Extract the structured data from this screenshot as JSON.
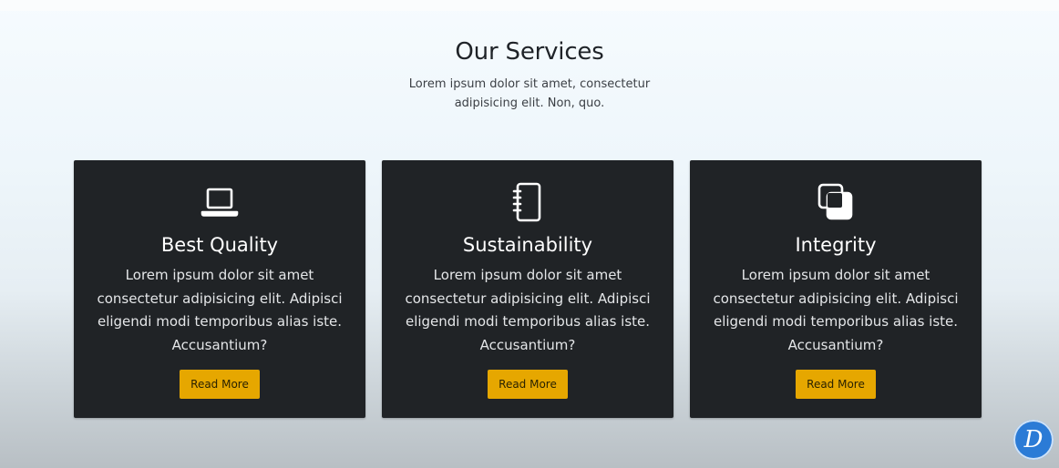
{
  "section": {
    "title": "Our Services",
    "subtitle": "Lorem ipsum dolor sit amet, consectetur adipisicing elit. Non, quo."
  },
  "cards": [
    {
      "icon": "laptop-icon",
      "title": "Best Quality",
      "text": "Lorem ipsum dolor sit amet consectetur adipisicing elit. Adipisci eligendi modi temporibus alias iste. Accusantium?",
      "button_label": "Read More"
    },
    {
      "icon": "notebook-icon",
      "title": "Sustainability",
      "text": "Lorem ipsum dolor sit amet consectetur adipisicing elit. Adipisci eligendi modi temporibus alias iste. Accusantium?",
      "button_label": "Read More"
    },
    {
      "icon": "overlapping-squares-icon",
      "title": "Integrity",
      "text": "Lorem ipsum dolor sit amet consectetur adipisicing elit. Adipisci eligendi modi temporibus alias iste. Accusantium?",
      "button_label": "Read More"
    }
  ],
  "logo": {
    "icon": "d-logo-icon",
    "letter": "D"
  },
  "colors": {
    "card_background": "#202326",
    "button_accent": "#e6a700",
    "logo_blue": "#2b7bd6"
  }
}
